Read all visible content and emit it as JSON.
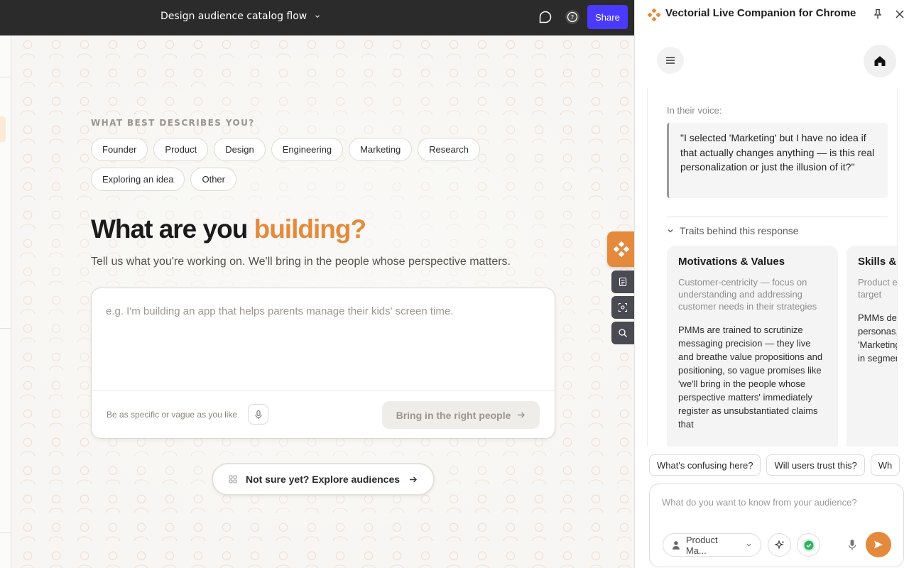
{
  "topbar": {
    "doc_title": "Design audience catalog flow",
    "share_label": "Share"
  },
  "onboarding": {
    "describe_label": "WHAT BEST DESCRIBES YOU?",
    "roles": [
      "Founder",
      "Product",
      "Design",
      "Engineering",
      "Marketing",
      "Research",
      "Exploring an idea",
      "Other"
    ],
    "headline_main": "What are you ",
    "headline_highlight": "building?",
    "subhead": "Tell us what you're working on. We'll bring in the people whose perspective matters.",
    "prompt_placeholder": "e.g. I'm building an app that helps parents manage their kids' screen time.",
    "hint": "Be as specific or vague as you like",
    "bring_label": "Bring in the right people",
    "explore_label": "Not sure yet? Explore audiences"
  },
  "panel": {
    "title": "Vectorial Live Companion for Chrome",
    "voice_label": "In their voice:",
    "quote": "\"I selected 'Marketing' but I have no idea if that actually changes anything — is this real personalization or just the illusion of it?\"",
    "traits_label": "Traits behind this response",
    "traits": [
      {
        "title": "Motivations & Values",
        "subtitle": "Customer-centricity — focus on understanding and addressing customer needs in their strategies",
        "body": "PMMs are trained to scrutinize messaging precision — they live and breathe value propositions and positioning, so vague promises like 'we'll bring in the people whose perspective matters' immediately register as unsubstantiated claims that"
      },
      {
        "title": "Skills & Expertise",
        "subtitle": "Product expertise in solutions for target",
        "body": "PMMs define audiences and personas, so the immediate 'Marketing' label without a list rooted in segments feels like messaging"
      }
    ],
    "suggestions": [
      "What's confusing here?",
      "Will users trust this?",
      "Wh"
    ],
    "composer_placeholder": "What do you want to know from your audience?",
    "persona_label": "Product Ma...",
    "colors": {
      "accent": "#e58a3c",
      "share": "#4a3aff",
      "success": "#2fb360"
    }
  }
}
